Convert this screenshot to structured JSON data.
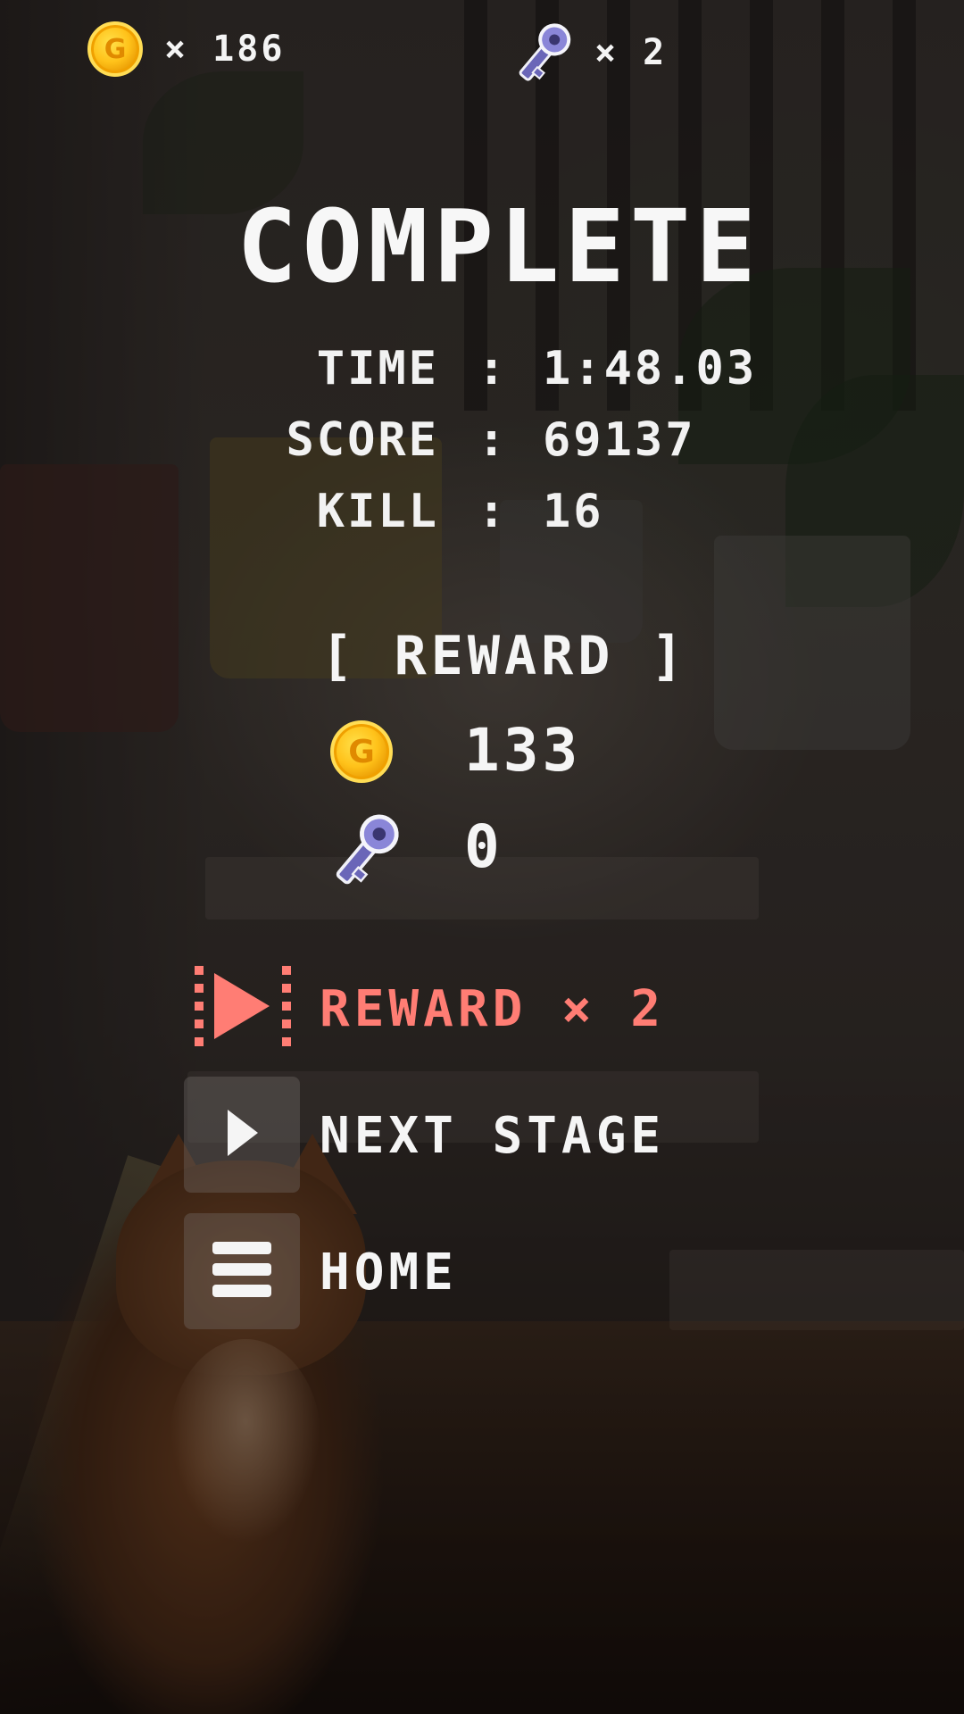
{
  "hud": {
    "coins": "× 186",
    "keys": "× 2"
  },
  "result": {
    "title": "COMPLETE",
    "stats": [
      {
        "label": "TIME",
        "colon": ":",
        "value": "1:48.03"
      },
      {
        "label": "SCORE",
        "colon": ":",
        "value": "69137"
      },
      {
        "label": "KILL",
        "colon": ":",
        "value": "16"
      }
    ]
  },
  "reward": {
    "heading": "[ REWARD ]",
    "coin_icon_letter": "G",
    "coins": "133",
    "keys": "0"
  },
  "menu": {
    "reward_x2": "REWARD × 2",
    "next_stage": "NEXT STAGE",
    "home": "HOME"
  },
  "colors": {
    "reward_button": "#ff7d74",
    "coin": "#ffc21a",
    "key": "#8a86d8"
  },
  "icons": [
    "coin-icon",
    "key-icon",
    "skip-video-icon",
    "play-icon",
    "menu-icon"
  ]
}
